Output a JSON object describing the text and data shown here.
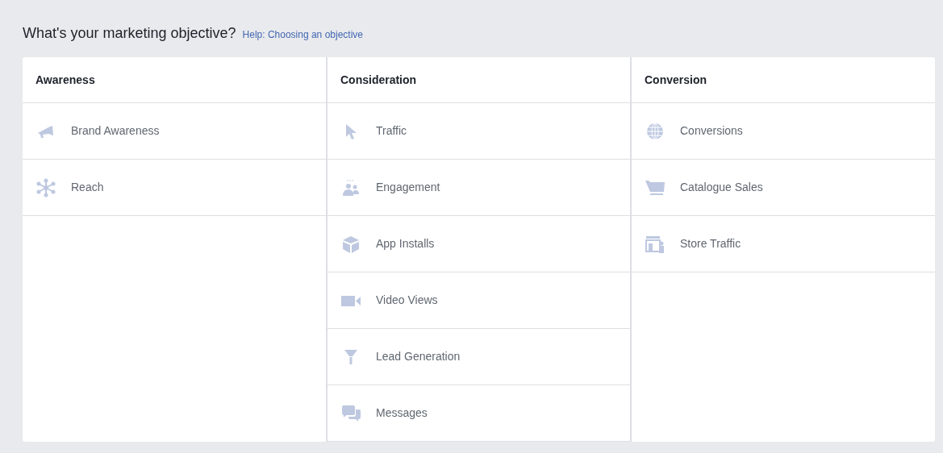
{
  "title": "What's your marketing objective?",
  "help_link": "Help: Choosing an objective",
  "columns": [
    {
      "heading": "Awareness",
      "items": [
        "Brand Awareness",
        "Reach"
      ]
    },
    {
      "heading": "Consideration",
      "items": [
        "Traffic",
        "Engagement",
        "App Installs",
        "Video Views",
        "Lead Generation",
        "Messages"
      ]
    },
    {
      "heading": "Conversion",
      "items": [
        "Conversions",
        "Catalogue Sales",
        "Store Traffic"
      ]
    }
  ]
}
